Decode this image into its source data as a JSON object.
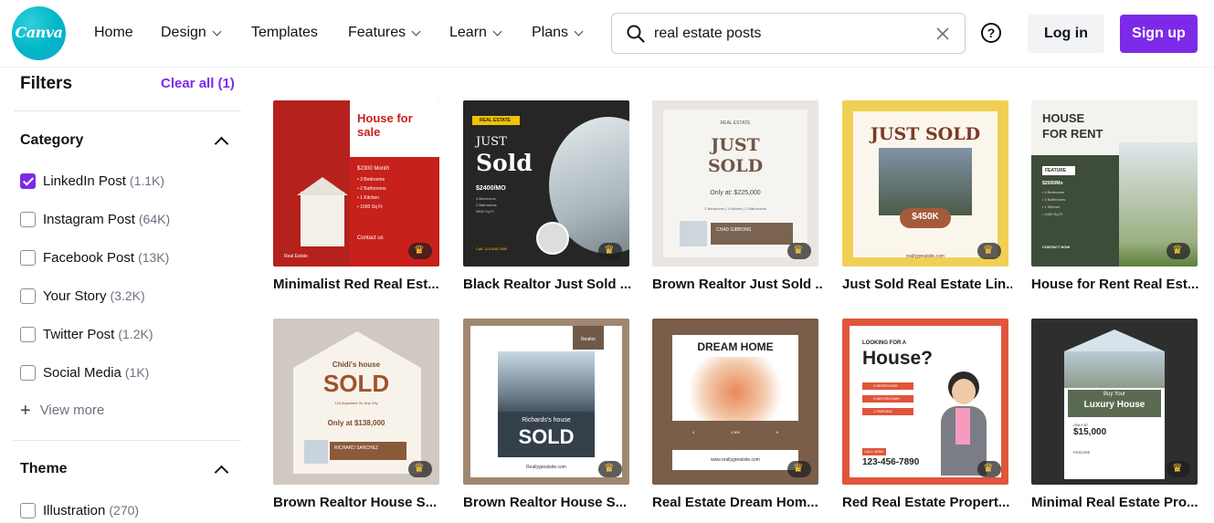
{
  "header": {
    "logo_text": "Canva",
    "nav": [
      {
        "label": "Home",
        "has_dropdown": false
      },
      {
        "label": "Design",
        "has_dropdown": true
      },
      {
        "label": "Templates",
        "has_dropdown": false
      },
      {
        "label": "Features",
        "has_dropdown": true
      },
      {
        "label": "Learn",
        "has_dropdown": true
      },
      {
        "label": "Plans",
        "has_dropdown": true
      }
    ],
    "search": {
      "value": "real estate posts"
    },
    "help_label": "?",
    "login_label": "Log in",
    "signup_label": "Sign up"
  },
  "colors": {
    "accent": "#7d2ae8",
    "brand": "#00c4cc"
  },
  "sidebar": {
    "title": "Filters",
    "clear_all": "Clear all (1)",
    "category": {
      "title": "Category",
      "items": [
        {
          "label": "LinkedIn Post",
          "count": "(1.1K)",
          "checked": true
        },
        {
          "label": "Instagram Post",
          "count": "(64K)",
          "checked": false
        },
        {
          "label": "Facebook Post",
          "count": "(13K)",
          "checked": false
        },
        {
          "label": "Your Story",
          "count": "(3.2K)",
          "checked": false
        },
        {
          "label": "Twitter Post",
          "count": "(1.2K)",
          "checked": false
        },
        {
          "label": "Social Media",
          "count": "(1K)",
          "checked": false
        }
      ],
      "view_more": "View more"
    },
    "theme": {
      "title": "Theme",
      "items": [
        {
          "label": "Illustration",
          "count": "(270)",
          "checked": false
        }
      ]
    }
  },
  "results": [
    {
      "title": "Minimalist Red Real Est...",
      "thumb": {
        "heading": "House for sale",
        "price": "$2300 Month",
        "features": [
          "• 3 Bedrooms",
          "• 2 Bathrooms",
          "• 1 Kitchen",
          "• 1000 Sq Ft"
        ],
        "contact": "Contact us",
        "footer": "Real Estate"
      }
    },
    {
      "title": "Black Realtor Just Sold ...",
      "thumb": {
        "badge": "REAL ESTATE",
        "line1": "JUST",
        "line2": "Sold",
        "price": "$2400/MO",
        "features": [
          "4 Bedrooms",
          "2 Bathrooms",
          "2800 Sq Ft"
        ],
        "call": "Call: 123-456-7890"
      }
    },
    {
      "title": "Brown Realtor Just Sold ...",
      "thumb": {
        "brand": "REAL ESTATE",
        "line1": "JUST",
        "line2": "SOLD",
        "price": "Only at: $225,000",
        "features": "2 Bedrooms  |  1 Kitchen  |  2 Bathrooms",
        "agent": "CHAD GIBBONS"
      }
    },
    {
      "title": "Just Sold Real Estate Lin...",
      "thumb": {
        "heading": "JUST SOLD",
        "price": "$450K",
        "footer": "reallygreatsite.com"
      }
    },
    {
      "title": "House for Rent Real Est...",
      "thumb": {
        "line1": "HOUSE",
        "line2": "FOR RENT",
        "badge": "FEATURE",
        "price": "$2500/Mo",
        "features": [
          "• 4 Bedrooms",
          "• 3 Bathrooms",
          "• 1 Kitchen",
          "• 2400 Sq Ft"
        ],
        "contact": "CONTACT NOW"
      }
    },
    {
      "title": "Brown Realtor House S...",
      "thumb": {
        "line1": "Chidi's house",
        "line2": "SOLD",
        "address": "123 Anywhere St. Any City",
        "price": "Only at $138,000",
        "agent": "RICHARD SANCHEZ"
      }
    },
    {
      "title": "Brown Realtor House S...",
      "thumb": {
        "badge": "Realtor",
        "line1": "Richards's house",
        "line2": "SOLD",
        "footer": "Reallygreatsite.com"
      }
    },
    {
      "title": "Real Estate Dream Hom...",
      "thumb": {
        "heading": "DREAM HOME",
        "stats": [
          "4",
          "2,500",
          "6"
        ],
        "footer": "www.reallygreatsite.com"
      }
    },
    {
      "title": "Red Real Estate Propert...",
      "thumb": {
        "line1": "LOOKING FOR A",
        "line2": "House?",
        "features": [
          "4 BEDROOMS",
          "2 BATHROOMS",
          "1 PARKING"
        ],
        "call_label": "CALL NOW",
        "phone": "123-456-7890"
      }
    },
    {
      "title": "Minimal Real Estate Pro...",
      "thumb": {
        "line1": "Buy Your",
        "line2": "Luxury House",
        "only": "ONLY AT",
        "price": "$15,000",
        "feature": "FEATURE"
      }
    }
  ]
}
